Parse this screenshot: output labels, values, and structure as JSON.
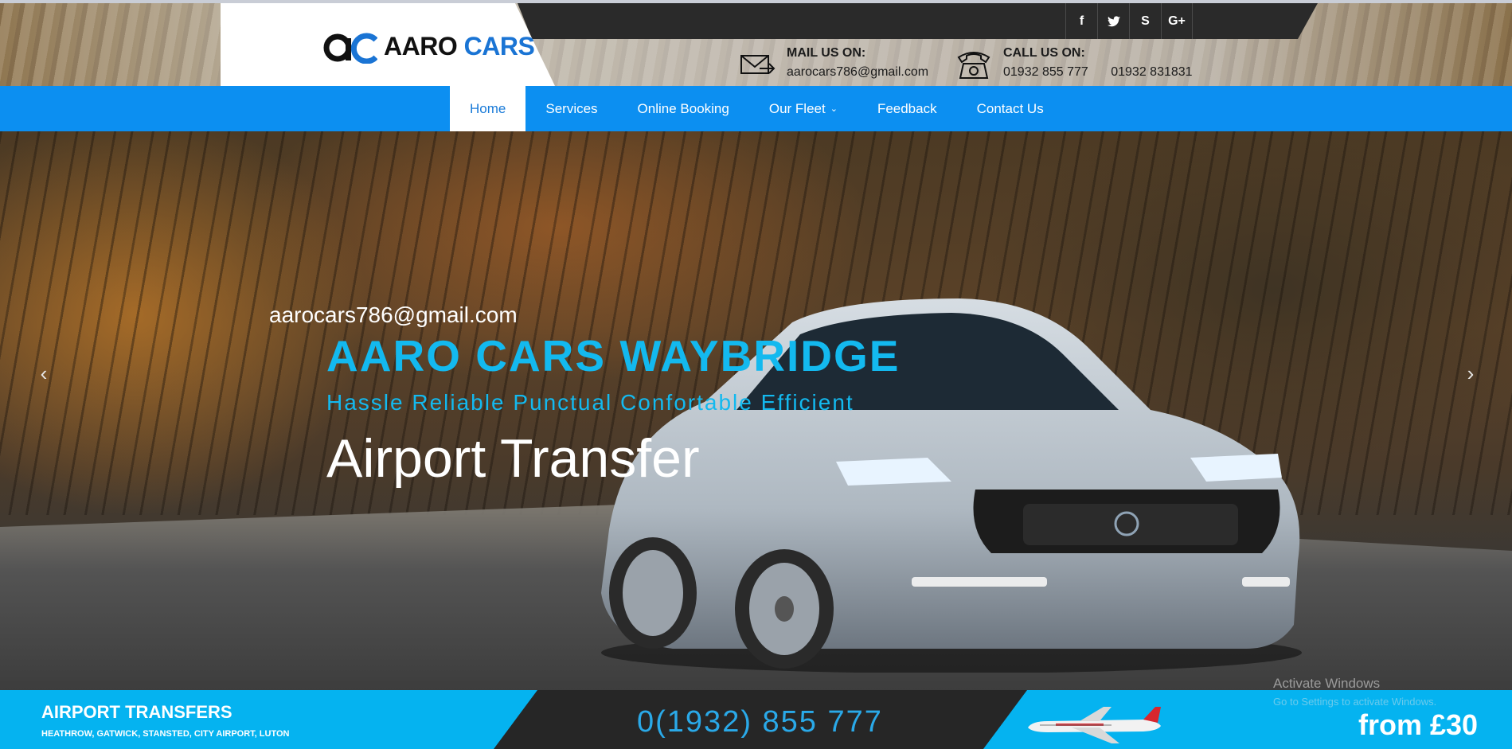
{
  "brand": {
    "word1": "AARO",
    "word2": "CARS"
  },
  "social": [
    "f",
    "t",
    "S",
    "G+"
  ],
  "contact": {
    "mail_title": "MAIL US ON:",
    "mail_value": "aarocars786@gmail.com",
    "call_title": "CALL US ON:",
    "phone1": "01932 855 777",
    "phone2": "01932 831831"
  },
  "nav": {
    "items": [
      {
        "label": "Home"
      },
      {
        "label": "Services"
      },
      {
        "label": "Online Booking"
      },
      {
        "label": "Our Fleet"
      },
      {
        "label": "Feedback"
      },
      {
        "label": "Contact Us"
      }
    ],
    "fleet_chevron": "⌄"
  },
  "hero": {
    "email": "aarocars786@gmail.com",
    "title": "AARO CARS WAYBRIDGE",
    "subtitle": "Hassle Reliable Punctual Confortable Efficient",
    "headline": "Airport Transfer",
    "prev": "‹",
    "next": "›"
  },
  "bottom": {
    "title": "AIRPORT TRANSFERS",
    "airports": "HEATHROW, GATWICK, STANSTED, CITY AIRPORT, LUTON",
    "phone": "0(1932) 855 777",
    "price": "from £30"
  },
  "watermark": {
    "line1": "Activate Windows",
    "line2": "Go to Settings to activate Windows."
  },
  "colors": {
    "nav_blue": "#0c8ff1",
    "accent_cyan": "#13b9ef",
    "bottom_cyan": "#05b3f0"
  }
}
